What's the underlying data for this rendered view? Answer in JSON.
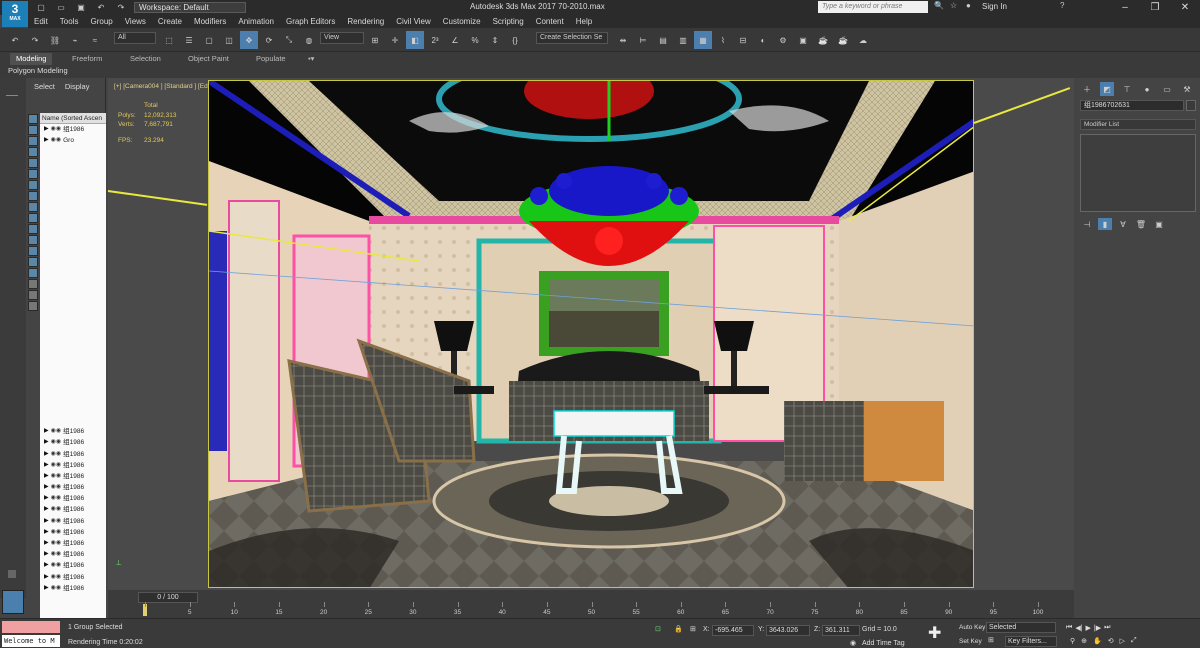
{
  "app": {
    "logo_text": "3",
    "logo_sub": "MAX",
    "workspace": "Workspace: Default",
    "window_title": "Autodesk 3ds Max 2017     70-2010.max",
    "search_placeholder": "Type a keyword or phrase",
    "signin": "Sign In"
  },
  "menu": [
    "Edit",
    "Tools",
    "Group",
    "Views",
    "Create",
    "Modifiers",
    "Animation",
    "Graph Editors",
    "Rendering",
    "Civil View",
    "Customize",
    "Scripting",
    "Content",
    "Help"
  ],
  "toolbar": {
    "selection_filter": "All",
    "ref_coord": "View",
    "selection_set": "Create Selection Se"
  },
  "ribbon": {
    "tabs": [
      "Modeling",
      "Freeform",
      "Selection",
      "Object Paint",
      "Populate"
    ],
    "sub_label": "Polygon Modeling"
  },
  "explorer": {
    "tabs": [
      "Select",
      "Display"
    ],
    "header": "Name (Sorted Ascen",
    "rows": [
      "组1986",
      "Gro",
      "",
      "",
      "",
      "",
      "",
      "",
      "",
      "",
      "",
      "",
      "",
      "",
      "",
      "",
      "",
      "",
      "",
      "",
      "",
      "",
      "",
      "",
      "",
      "",
      "",
      "组1986",
      "组1986",
      "组1986",
      "组1986",
      "组1986",
      "组1986",
      "组1986",
      "组1986",
      "组1986",
      "组1986",
      "组1986",
      "组1986",
      "组1986",
      "组1986",
      "组1986"
    ]
  },
  "viewport": {
    "label": "[+] [Camera004 ] [Standard ] [Edged Faces ]",
    "stats_total": "Total",
    "polys_label": "Polys:",
    "polys_value": "12,092,313",
    "verts_label": "Verts:",
    "verts_value": "7,687,791",
    "fps_label": "FPS:",
    "fps_value": "23.294"
  },
  "command_panel": {
    "object_name": "组1986702631",
    "modifier_list": "Modifier List"
  },
  "timeline": {
    "frame_indicator": "0 / 100",
    "ticks": [
      "0",
      "5",
      "10",
      "15",
      "20",
      "25",
      "30",
      "35",
      "40",
      "45",
      "50",
      "55",
      "60",
      "65",
      "70",
      "75",
      "80",
      "85",
      "90",
      "95",
      "100"
    ]
  },
  "status": {
    "maxscript": "",
    "listener": "Welcome to M",
    "selection": "1 Group Selected",
    "render_time": "Rendering Time  0:20:02",
    "x_label": "X:",
    "x_value": "-695.465",
    "y_label": "Y:",
    "y_value": "3643.026",
    "z_label": "Z:",
    "z_value": "361.311",
    "grid": "Grid = 10.0",
    "add_time_tag": "Add Time Tag",
    "auto_key": "Auto Key",
    "set_key": "Set Key",
    "selected": "Selected",
    "key_filters": "Key Filters..."
  },
  "colors": {
    "accent": "#1d7fb8",
    "stats": "#e2c85a",
    "viewport_border": "#c8c840"
  }
}
